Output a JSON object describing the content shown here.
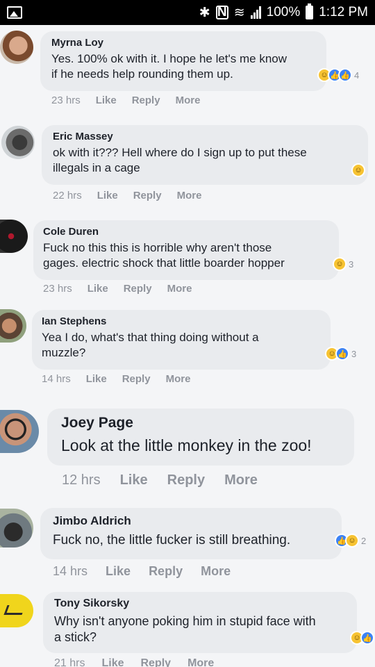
{
  "status": {
    "battery": "100%",
    "time": "1:12 PM"
  },
  "actions": {
    "like": "Like",
    "reply": "Reply",
    "more": "More"
  },
  "comments": [
    {
      "author": "Myrna Loy",
      "line1": "Yes. 100% ok with it. I hope he let's me know",
      "line2": "if he needs help rounding them up.",
      "time": "23 hrs",
      "reactions": [
        "haha",
        "like",
        "like"
      ],
      "count": "4"
    },
    {
      "author": "Eric Massey",
      "line1": "ok with it??? Hell where do I sign up to put these",
      "line2": "illegals in a cage",
      "time": "22 hrs",
      "reactions": [
        "haha"
      ],
      "count": ""
    },
    {
      "author": "Cole Duren",
      "line1": "Fuck no this this is horrible why aren't those",
      "line2": "gages. electric shock that little boarder hopper",
      "time": "23 hrs",
      "reactions": [
        "haha"
      ],
      "count": "3"
    },
    {
      "author": "Ian Stephens",
      "line1": "Yea I do, what's that thing doing without a",
      "line2": "muzzle?",
      "time": "14 hrs",
      "reactions": [
        "haha",
        "like"
      ],
      "count": "3"
    },
    {
      "author": "Joey Page",
      "line1": "Look at the little monkey in the zoo!",
      "line2": "",
      "time": "12 hrs",
      "reactions": [],
      "count": ""
    },
    {
      "author": "Jimbo Aldrich",
      "line1": "Fuck no, the little fucker is still breathing.",
      "line2": "",
      "time": "14 hrs",
      "reactions": [
        "like",
        "haha"
      ],
      "count": "2"
    },
    {
      "author": "Tony Sikorsky",
      "line1": "Why isn't anyone poking him in stupid face with",
      "line2": "a stick?",
      "time": "21 hrs",
      "reactions": [
        "haha",
        "like"
      ],
      "count": ""
    }
  ],
  "icons": {
    "haha": "haha-reaction-icon",
    "like": "like-reaction-icon"
  }
}
